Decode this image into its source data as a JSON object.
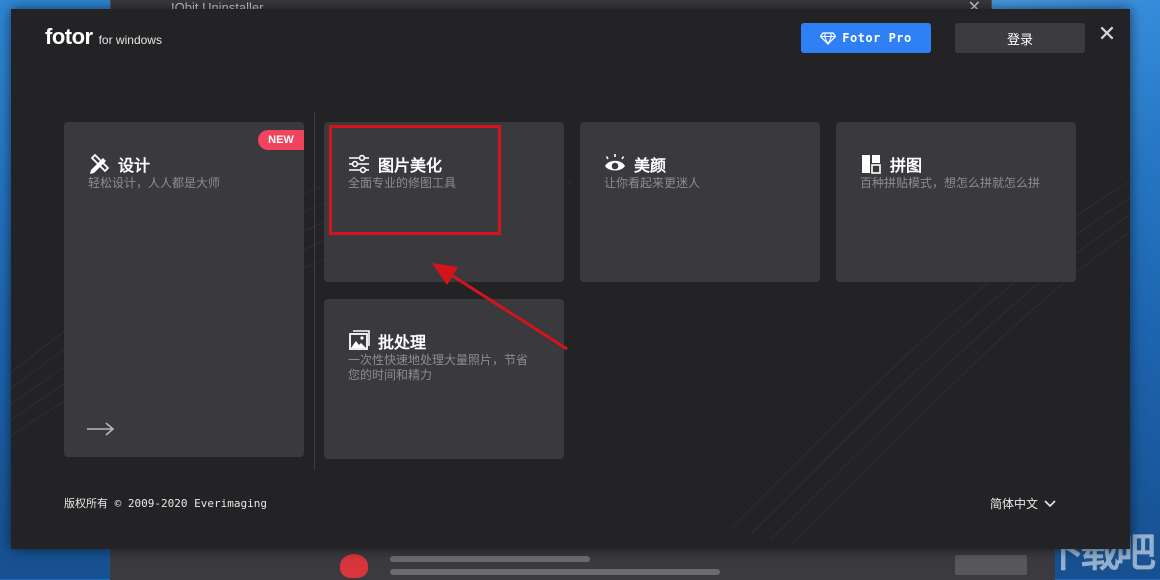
{
  "background": {
    "window_title": "IObit Uninstaller",
    "close_glyph": "✕"
  },
  "watermark": "下载吧",
  "app": {
    "logo_brand": "fotor",
    "logo_suffix": "for windows",
    "pro_button": "Fotor Pro",
    "login_button": "登录",
    "close_glyph": "✕",
    "accent_color": "#2f80f5"
  },
  "cards": {
    "design": {
      "title": "设计",
      "desc": "轻松设计，人人都是大师",
      "badge": "NEW",
      "icon": "pencil-ruler-icon"
    },
    "edit": {
      "title": "图片美化",
      "desc": "全面专业的修图工具",
      "icon": "sliders-icon"
    },
    "beauty": {
      "title": "美颜",
      "desc": "让你看起来更迷人",
      "icon": "eye-icon"
    },
    "collage": {
      "title": "拼图",
      "desc": "百种拼贴模式，想怎么拼就怎么拼",
      "icon": "collage-grid-icon"
    },
    "batch": {
      "title": "批处理",
      "desc_line1": "一次性快速地处理大量照片，节省",
      "desc_line2": "您的时间和精力",
      "icon": "image-stack-icon"
    }
  },
  "footer": {
    "copyright": "版权所有 © 2009-2020 Everimaging",
    "language": "简体中文"
  },
  "annotation_color": "#d4141b"
}
